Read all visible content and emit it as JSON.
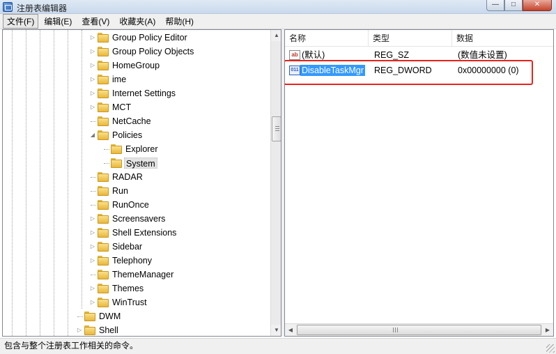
{
  "window": {
    "title": "注册表编辑器",
    "buttons": {
      "minimize": "—",
      "maximize": "□",
      "close": "✕"
    }
  },
  "menubar": {
    "items": [
      {
        "label": "文件(F)",
        "active": true
      },
      {
        "label": "编辑(E)"
      },
      {
        "label": "查看(V)"
      },
      {
        "label": "收藏夹(A)"
      },
      {
        "label": "帮助(H)"
      }
    ]
  },
  "tree": {
    "items": [
      {
        "label": "Group Policy Editor",
        "expander": "▷"
      },
      {
        "label": "Group Policy Objects",
        "expander": "▷"
      },
      {
        "label": "HomeGroup",
        "expander": "▷"
      },
      {
        "label": "ime",
        "expander": "▷"
      },
      {
        "label": "Internet Settings",
        "expander": "▷"
      },
      {
        "label": "MCT",
        "expander": "▷"
      },
      {
        "label": "NetCache",
        "expander": ""
      },
      {
        "label": "Policies",
        "expander": "◢"
      },
      {
        "label": "Explorer",
        "expander": ""
      },
      {
        "label": "System",
        "expander": "",
        "selected": true
      },
      {
        "label": "RADAR",
        "expander": ""
      },
      {
        "label": "Run",
        "expander": ""
      },
      {
        "label": "RunOnce",
        "expander": ""
      },
      {
        "label": "Screensavers",
        "expander": "▷"
      },
      {
        "label": "Shell Extensions",
        "expander": "▷"
      },
      {
        "label": "Sidebar",
        "expander": "▷"
      },
      {
        "label": "Telephony",
        "expander": "▷"
      },
      {
        "label": "ThemeManager",
        "expander": ""
      },
      {
        "label": "Themes",
        "expander": "▷"
      },
      {
        "label": "WinTrust",
        "expander": "▷"
      },
      {
        "label": "DWM",
        "expander": ""
      },
      {
        "label": "Shell",
        "expander": "▷"
      }
    ],
    "scroll": {
      "up": "▲",
      "down": "▼"
    }
  },
  "list": {
    "columns": {
      "name": "名称",
      "type": "类型",
      "data": "数据"
    },
    "rows": [
      {
        "icon": "string-value-icon",
        "icon_text": "ab",
        "name": "(默认)",
        "type": "REG_SZ",
        "data": "(数值未设置)"
      },
      {
        "icon": "dword-value-icon",
        "icon_text": "011",
        "name": "DisableTaskMgr",
        "type": "REG_DWORD",
        "data": "0x00000000 (0)",
        "selected": true
      }
    ],
    "scroll": {
      "left": "◀",
      "right": "▶"
    }
  },
  "statusbar": {
    "text": "包含与整个注册表工作相关的命令。"
  },
  "colors": {
    "selection": "#3399ff",
    "highlight_box": "#e8221b",
    "folder": "#f3cd5a"
  }
}
